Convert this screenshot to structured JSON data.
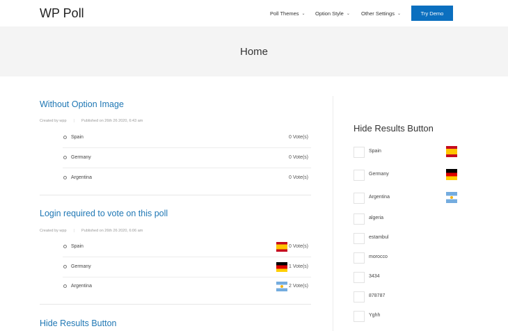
{
  "site": {
    "logo": "WP Poll"
  },
  "nav": {
    "items": [
      {
        "label": "Poll Themes"
      },
      {
        "label": "Option Style"
      },
      {
        "label": "Other Settings"
      }
    ],
    "cta": "Try Demo"
  },
  "page": {
    "title": "Home"
  },
  "posts": [
    {
      "title": "Without Option Image",
      "author": "Created by wpp",
      "published": "Published on 26th 26 2020, 6:43 am",
      "options": [
        {
          "name": "Spain",
          "votes": "0 Vote(s)",
          "flag": ""
        },
        {
          "name": "Germany",
          "votes": "0 Vote(s)",
          "flag": ""
        },
        {
          "name": "Argentina",
          "votes": "0 Vote(s)",
          "flag": ""
        }
      ]
    },
    {
      "title": "Login required to vote on this poll",
      "author": "Created by wpp",
      "published": "Published on 26th 26 2020, 6:06 am",
      "options": [
        {
          "name": "Spain",
          "votes": "0 Vote(s)",
          "flag": "spain-flag-icon"
        },
        {
          "name": "Germany",
          "votes": "1 Vote(s)",
          "flag": "germany-flag-icon"
        },
        {
          "name": "Argentina",
          "votes": "2 Vote(s)",
          "flag": "argentina-flag-icon"
        }
      ]
    },
    {
      "title": "Hide Results Button"
    }
  ],
  "sidebar": {
    "title": "Hide Results Button",
    "options": [
      {
        "name": "Spain",
        "flag": "spain-flag-icon"
      },
      {
        "name": "Germany",
        "flag": "germany-flag-icon"
      },
      {
        "name": "Argentina",
        "flag": "argentina-flag-icon"
      },
      {
        "name": "algeria"
      },
      {
        "name": "estambul"
      },
      {
        "name": "morocco"
      },
      {
        "name": "3434"
      },
      {
        "name": "878787"
      },
      {
        "name": "Yghh"
      }
    ]
  },
  "colors": {
    "accent": "#0b6fbf",
    "link": "#1f77b4",
    "band": "#f4f4f4"
  }
}
